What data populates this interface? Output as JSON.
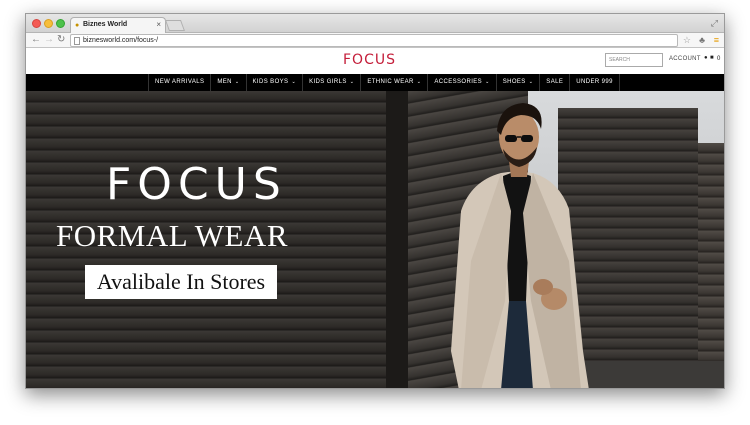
{
  "browser": {
    "tab_title": "Biznes World",
    "url": "biznesworld.com/focus-/",
    "close_glyph": "×"
  },
  "site": {
    "logo_text": "FOCUS",
    "search_placeholder": "SEARCH",
    "account_label": "ACCOUNT",
    "cart_count": "0",
    "brand_color": "#c41e3a"
  },
  "nav": {
    "items": [
      {
        "label": "NEW ARRIVALS",
        "has_dropdown": false
      },
      {
        "label": "MEN",
        "has_dropdown": true
      },
      {
        "label": "KIDS BOYS",
        "has_dropdown": true
      },
      {
        "label": "KIDS GIRLS",
        "has_dropdown": true
      },
      {
        "label": "ETHNIC WEAR",
        "has_dropdown": true
      },
      {
        "label": "ACCESSORIES",
        "has_dropdown": true
      },
      {
        "label": "SHOES",
        "has_dropdown": true
      },
      {
        "label": "SALE",
        "has_dropdown": false
      },
      {
        "label": "UNDER 999",
        "has_dropdown": false
      }
    ]
  },
  "hero": {
    "logo_text": "FOCUS",
    "title": "FORMAL WEAR",
    "cta_label": "Avalibale In Stores"
  }
}
